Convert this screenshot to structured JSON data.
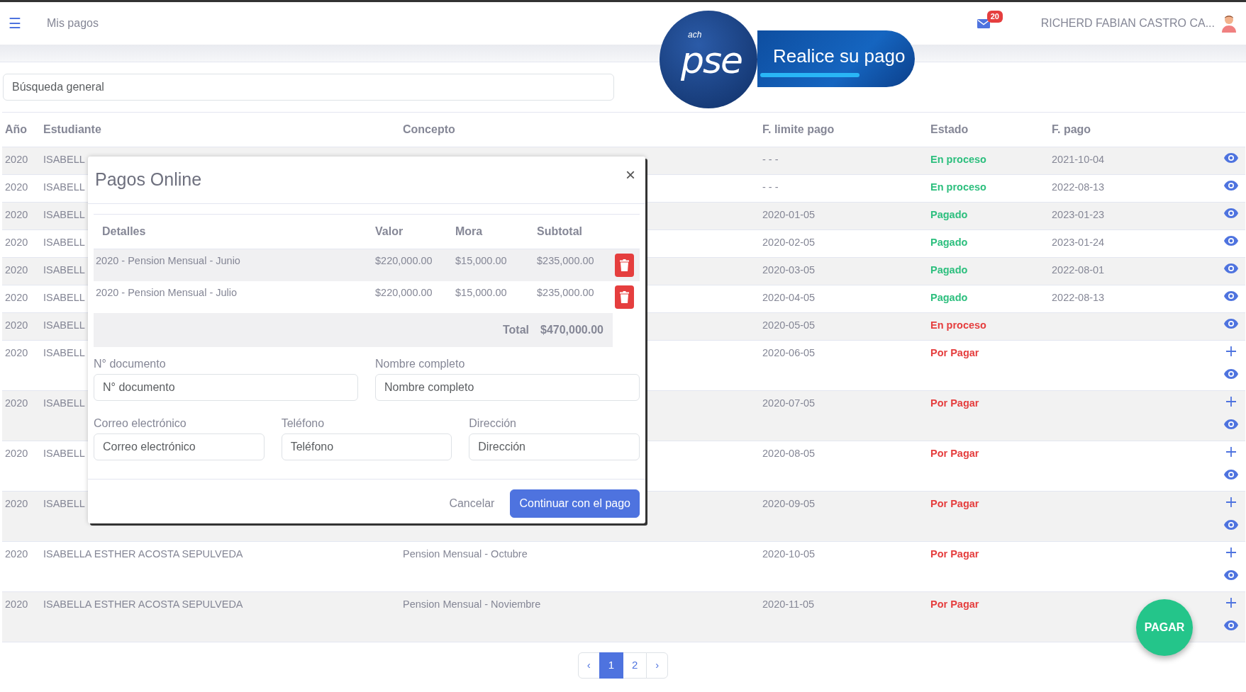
{
  "navbar": {
    "menu_icon": "☰",
    "title": "Mis pagos",
    "notifications": "20",
    "user": "RICHERD FABIAN CASTRO CA..."
  },
  "pse_banner": {
    "small": "ach",
    "brand": "pse",
    "tagline": "Realice su pago"
  },
  "search": {
    "placeholder": "Búsqueda general"
  },
  "table": {
    "columns": [
      "Año",
      "Estudiante",
      "Concepto",
      "F. limite pago",
      "Estado",
      "F. pago"
    ],
    "rows": [
      {
        "year": "2020",
        "student": "ISABELL",
        "limit": "- - -",
        "status": "En proceso",
        "color": "#2dbf7e",
        "paid": "2021-10-04",
        "can_add": false
      },
      {
        "year": "2020",
        "student": "ISABELL",
        "limit": "- - -",
        "status": "En proceso",
        "color": "#2dbf7e",
        "paid": "2022-08-13",
        "can_add": false
      },
      {
        "year": "2020",
        "student": "ISABELL",
        "limit": "2020-01-05",
        "status": "Pagado",
        "color": "#2dbf7e",
        "paid": "2023-01-23",
        "can_add": false
      },
      {
        "year": "2020",
        "student": "ISABELL",
        "limit": "2020-02-05",
        "status": "Pagado",
        "color": "#2dbf7e",
        "paid": "2023-01-24",
        "can_add": false
      },
      {
        "year": "2020",
        "student": "ISABELL",
        "limit": "2020-03-05",
        "status": "Pagado",
        "color": "#2dbf7e",
        "paid": "2022-08-01",
        "can_add": false
      },
      {
        "year": "2020",
        "student": "ISABELL",
        "limit": "2020-04-05",
        "status": "Pagado",
        "color": "#2dbf7e",
        "paid": "2022-08-13",
        "can_add": false
      },
      {
        "year": "2020",
        "student": "ISABELL",
        "limit": "2020-05-05",
        "status": "En proceso",
        "color": "#e53e3e",
        "can_add": false
      },
      {
        "year": "2020",
        "student": "ISABELL",
        "limit": "2020-06-05",
        "status": "Por Pagar",
        "color": "#e53e3e",
        "can_add": true
      },
      {
        "year": "2020",
        "student": "ISABELL",
        "limit": "2020-07-05",
        "status": "Por Pagar",
        "color": "#e53e3e",
        "can_add": true
      },
      {
        "year": "2020",
        "student": "ISABELL",
        "limit": "2020-08-05",
        "status": "Por Pagar",
        "color": "#e53e3e",
        "can_add": true
      },
      {
        "year": "2020",
        "student": "ISABELL",
        "limit": "2020-09-05",
        "status": "Por Pagar",
        "color": "#e53e3e",
        "can_add": true
      },
      {
        "year": "2020",
        "student": "ISABELLA ESTHER ACOSTA SEPULVEDA",
        "concept": "Pension Mensual - Octubre",
        "limit": "2020-10-05",
        "status": "Por Pagar",
        "color": "#e53e3e",
        "can_add": true
      },
      {
        "year": "2020",
        "student": "ISABELLA ESTHER ACOSTA SEPULVEDA",
        "concept": "Pension Mensual - Noviembre",
        "limit": "2020-11-05",
        "status": "Por Pagar",
        "color": "#e53e3e",
        "can_add": true
      }
    ]
  },
  "pagination": [
    {
      "label": "‹",
      "selected": false
    },
    {
      "label": "1",
      "selected": true
    },
    {
      "label": "2",
      "selected": false
    },
    {
      "label": "›",
      "selected": false
    }
  ],
  "pay_fab": "PAGAR",
  "modal": {
    "title": "Pagos Online",
    "close": "×",
    "columns": [
      "Detalles",
      "Valor",
      "Mora",
      "Subtotal"
    ],
    "items": [
      {
        "detail": "2020 - Pension Mensual - Junio",
        "value": "$220,000.00",
        "late": "$15,000.00",
        "subtotal": "$235,000.00"
      },
      {
        "detail": "2020 - Pension Mensual - Julio",
        "value": "$220,000.00",
        "late": "$15,000.00",
        "subtotal": "$235,000.00"
      }
    ],
    "total_label": "Total",
    "total": "$470,000.00",
    "fields": [
      {
        "label": "N° documento",
        "placeholder": "N° documento"
      },
      {
        "label": "Nombre completo",
        "placeholder": "Nombre completo"
      },
      {
        "label": "Correo electrónico",
        "placeholder": "Correo electrónico"
      },
      {
        "label": "Teléfono",
        "placeholder": "Teléfono"
      },
      {
        "label": "Dirección",
        "placeholder": "Dirección"
      }
    ],
    "cancel": "Cancelar",
    "submit": "Continuar con el pago"
  }
}
